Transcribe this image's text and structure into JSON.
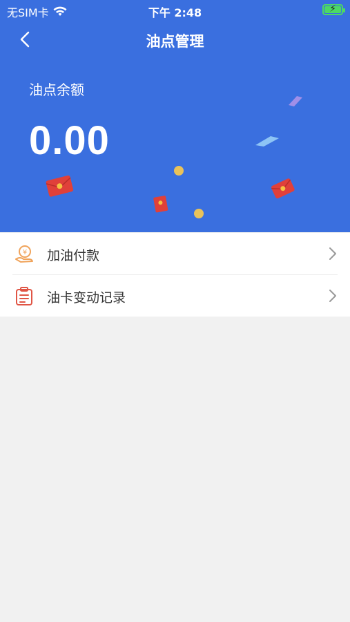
{
  "status_bar": {
    "carrier": "无SIM卡",
    "time": "下午 2:48",
    "battery_icon": "battery-charging-icon",
    "wifi_icon": "wifi-icon"
  },
  "nav": {
    "title": "油点管理",
    "back_icon": "chevron-left-icon"
  },
  "balance": {
    "label": "油点余额",
    "value": "0.00"
  },
  "menu": [
    {
      "label": "加油付款",
      "icon": "yuan-hand-icon",
      "arrow_icon": "chevron-right-icon"
    },
    {
      "label": "油卡变动记录",
      "icon": "clipboard-list-icon",
      "arrow_icon": "chevron-right-icon"
    }
  ],
  "colors": {
    "header_bg": "#3a6fdf",
    "page_bg": "#f1f1f1",
    "icon_orange": "#f0a35a",
    "icon_red": "#e05545"
  }
}
